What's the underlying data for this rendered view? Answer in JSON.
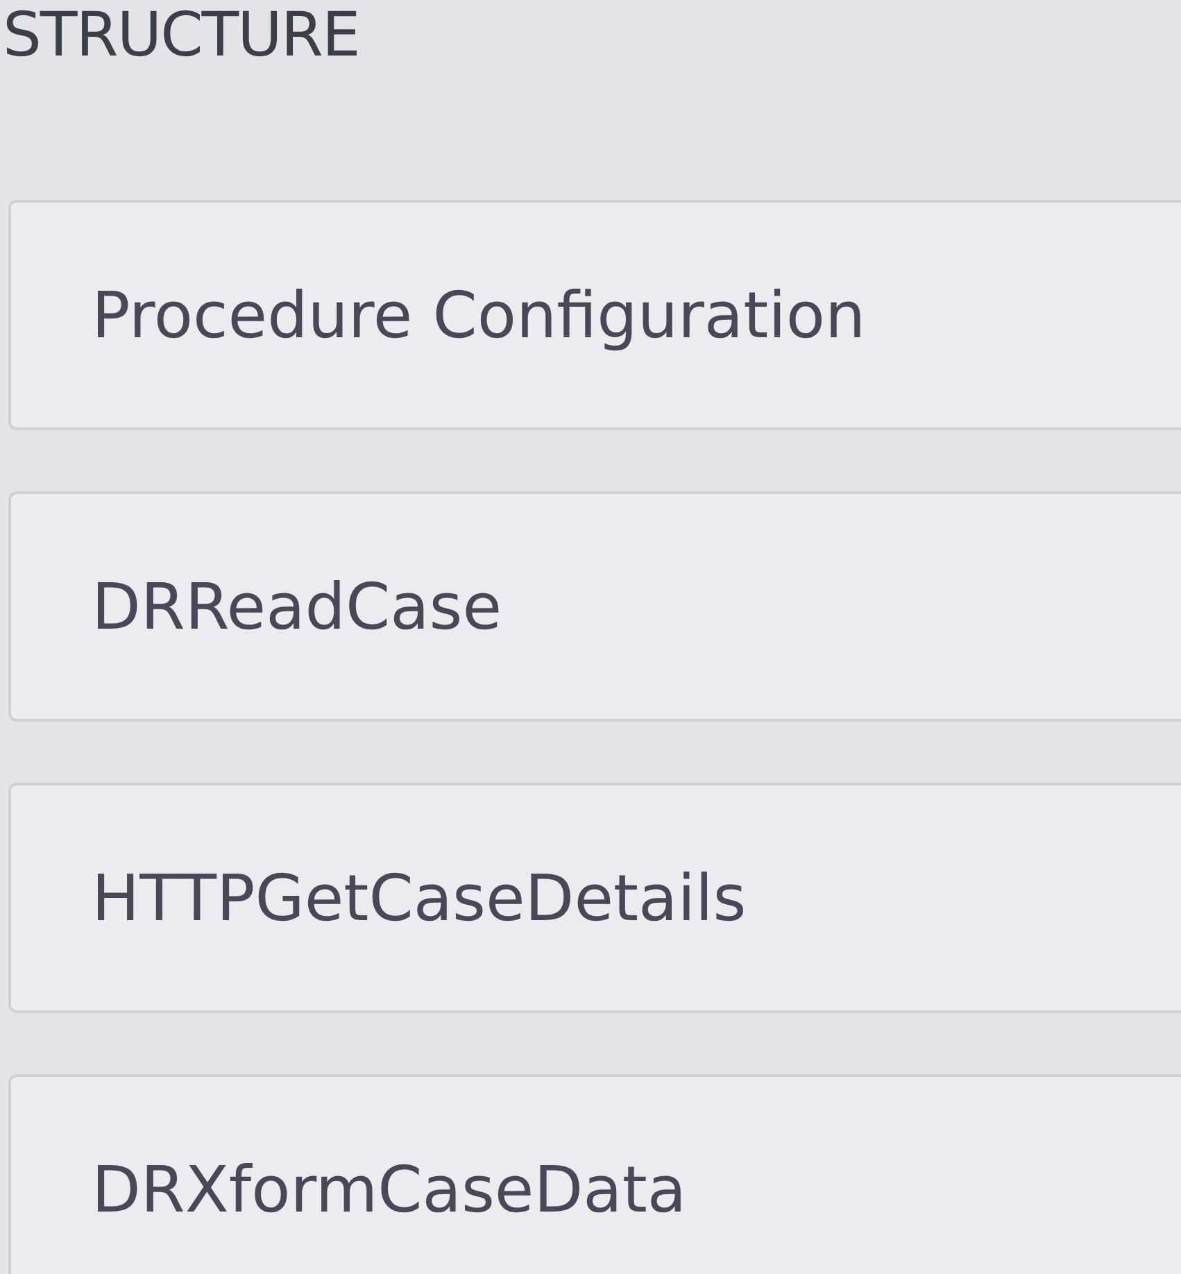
{
  "section_title": "STRUCTURE",
  "steps": [
    {
      "label": "Procedure Configuration"
    },
    {
      "label": "DRReadCase"
    },
    {
      "label": "HTTPGetCaseDetails"
    },
    {
      "label": "DRXformCaseData"
    }
  ]
}
